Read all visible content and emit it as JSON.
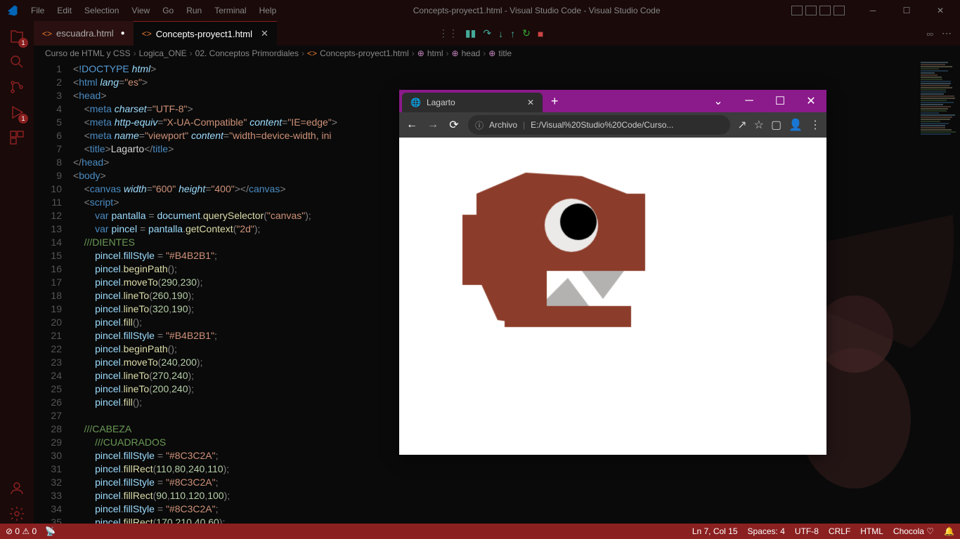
{
  "titlebar": {
    "menu": [
      "File",
      "Edit",
      "Selection",
      "View",
      "Go",
      "Run",
      "Terminal",
      "Help"
    ],
    "title": "Concepts-proyect1.html - Visual Studio Code - Visual Studio Code"
  },
  "activitybar": {
    "explorer_badge": "1",
    "debug_badge": "1"
  },
  "tabs": {
    "items": [
      {
        "name": "escuadra.html",
        "active": false,
        "modified": true
      },
      {
        "name": "Concepts-proyect1.html",
        "active": true,
        "modified": false
      }
    ]
  },
  "breadcrumb": {
    "items": [
      "Curso de HTML y CSS",
      "Logica_ONE",
      "02. Conceptos Primordiales",
      "Concepts-proyect1.html",
      "html",
      "head",
      "title"
    ]
  },
  "code": {
    "lines": [
      {
        "n": 1,
        "html": "<span class='k-punc'>&lt;</span><span class='k-doc'>!DOCTYPE</span> <span class='k-attr'>html</span><span class='k-punc'>&gt;</span>"
      },
      {
        "n": 2,
        "html": "<span class='k-punc'>&lt;</span><span class='k-tag'>html</span> <span class='k-attr'>lang</span><span class='k-punc'>=</span><span class='k-str'>\"es\"</span><span class='k-punc'>&gt;</span>"
      },
      {
        "n": 3,
        "html": "<span class='k-punc'>&lt;</span><span class='k-tag'>head</span><span class='k-punc'>&gt;</span>"
      },
      {
        "n": 4,
        "html": "    <span class='k-punc'>&lt;</span><span class='k-tag'>meta</span> <span class='k-attr'>charset</span><span class='k-punc'>=</span><span class='k-str'>\"UTF-8\"</span><span class='k-punc'>&gt;</span>"
      },
      {
        "n": 5,
        "html": "    <span class='k-punc'>&lt;</span><span class='k-tag'>meta</span> <span class='k-attr'>http-equiv</span><span class='k-punc'>=</span><span class='k-str'>\"X-UA-Compatible\"</span> <span class='k-attr'>content</span><span class='k-punc'>=</span><span class='k-str'>\"IE=edge\"</span><span class='k-punc'>&gt;</span>"
      },
      {
        "n": 6,
        "html": "    <span class='k-punc'>&lt;</span><span class='k-tag'>meta</span> <span class='k-attr'>name</span><span class='k-punc'>=</span><span class='k-str'>\"viewport\"</span> <span class='k-attr'>content</span><span class='k-punc'>=</span><span class='k-str'>\"width=device-width, ini</span>"
      },
      {
        "n": 7,
        "html": "    <span class='k-punc'>&lt;</span><span class='k-tag'>title</span><span class='k-punc'>&gt;</span>Lagarto<span class='k-punc'>&lt;/</span><span class='k-tag'>title</span><span class='k-punc'>&gt;</span>"
      },
      {
        "n": 8,
        "html": "<span class='k-punc'>&lt;/</span><span class='k-tag'>head</span><span class='k-punc'>&gt;</span>"
      },
      {
        "n": 9,
        "html": "<span class='k-punc'>&lt;</span><span class='k-tag'>body</span><span class='k-punc'>&gt;</span>"
      },
      {
        "n": 10,
        "html": "    <span class='k-punc'>&lt;</span><span class='k-tag'>canvas</span> <span class='k-attr'>width</span><span class='k-punc'>=</span><span class='k-str'>\"600\"</span> <span class='k-attr'>height</span><span class='k-punc'>=</span><span class='k-str'>\"400\"</span><span class='k-punc'>&gt;&lt;/</span><span class='k-tag'>canvas</span><span class='k-punc'>&gt;</span>"
      },
      {
        "n": 11,
        "html": "    <span class='k-punc'>&lt;</span><span class='k-tag'>script</span><span class='k-punc'>&gt;</span>"
      },
      {
        "n": 12,
        "html": "        <span class='k-kw'>var</span> <span class='k-var'>pantalla</span> <span class='k-punc'>=</span> <span class='k-obj'>document</span><span class='k-punc'>.</span><span class='k-func'>querySelector</span><span class='k-punc'>(</span><span class='k-str'>\"canvas\"</span><span class='k-punc'>);</span>"
      },
      {
        "n": 13,
        "html": "        <span class='k-kw'>var</span> <span class='k-var'>pincel</span> <span class='k-punc'>=</span> <span class='k-obj'>pantalla</span><span class='k-punc'>.</span><span class='k-func'>getContext</span><span class='k-punc'>(</span><span class='k-str'>\"2d\"</span><span class='k-punc'>);</span>"
      },
      {
        "n": 14,
        "html": "    <span class='k-com'>///DIENTES</span>"
      },
      {
        "n": 15,
        "html": "        <span class='k-obj'>pincel</span><span class='k-punc'>.</span><span class='k-var'>fillStyle</span> <span class='k-punc'>=</span> <span class='k-str'>\"#B4B2B1\"</span><span class='k-punc'>;</span>"
      },
      {
        "n": 16,
        "html": "        <span class='k-obj'>pincel</span><span class='k-punc'>.</span><span class='k-func'>beginPath</span><span class='k-punc'>();</span>"
      },
      {
        "n": 17,
        "html": "        <span class='k-obj'>pincel</span><span class='k-punc'>.</span><span class='k-func'>moveTo</span><span class='k-punc'>(</span><span class='k-num'>290</span><span class='k-punc'>,</span><span class='k-num'>230</span><span class='k-punc'>);</span>"
      },
      {
        "n": 18,
        "html": "        <span class='k-obj'>pincel</span><span class='k-punc'>.</span><span class='k-func'>lineTo</span><span class='k-punc'>(</span><span class='k-num'>260</span><span class='k-punc'>,</span><span class='k-num'>190</span><span class='k-punc'>);</span>"
      },
      {
        "n": 19,
        "html": "        <span class='k-obj'>pincel</span><span class='k-punc'>.</span><span class='k-func'>lineTo</span><span class='k-punc'>(</span><span class='k-num'>320</span><span class='k-punc'>,</span><span class='k-num'>190</span><span class='k-punc'>);</span>"
      },
      {
        "n": 20,
        "html": "        <span class='k-obj'>pincel</span><span class='k-punc'>.</span><span class='k-func'>fill</span><span class='k-punc'>();</span>"
      },
      {
        "n": 21,
        "html": "        <span class='k-obj'>pincel</span><span class='k-punc'>.</span><span class='k-var'>fillStyle</span> <span class='k-punc'>=</span> <span class='k-str'>\"#B4B2B1\"</span><span class='k-punc'>;</span>"
      },
      {
        "n": 22,
        "html": "        <span class='k-obj'>pincel</span><span class='k-punc'>.</span><span class='k-func'>beginPath</span><span class='k-punc'>();</span>"
      },
      {
        "n": 23,
        "html": "        <span class='k-obj'>pincel</span><span class='k-punc'>.</span><span class='k-func'>moveTo</span><span class='k-punc'>(</span><span class='k-num'>240</span><span class='k-punc'>,</span><span class='k-num'>200</span><span class='k-punc'>);</span>"
      },
      {
        "n": 24,
        "html": "        <span class='k-obj'>pincel</span><span class='k-punc'>.</span><span class='k-func'>lineTo</span><span class='k-punc'>(</span><span class='k-num'>270</span><span class='k-punc'>,</span><span class='k-num'>240</span><span class='k-punc'>);</span>"
      },
      {
        "n": 25,
        "html": "        <span class='k-obj'>pincel</span><span class='k-punc'>.</span><span class='k-func'>lineTo</span><span class='k-punc'>(</span><span class='k-num'>200</span><span class='k-punc'>,</span><span class='k-num'>240</span><span class='k-punc'>);</span>"
      },
      {
        "n": 26,
        "html": "        <span class='k-obj'>pincel</span><span class='k-punc'>.</span><span class='k-func'>fill</span><span class='k-punc'>();</span>"
      },
      {
        "n": 27,
        "html": ""
      },
      {
        "n": 28,
        "html": "    <span class='k-com'>///CABEZA</span>"
      },
      {
        "n": 29,
        "html": "        <span class='k-com'>///CUADRADOS</span>"
      },
      {
        "n": 30,
        "html": "        <span class='k-obj'>pincel</span><span class='k-punc'>.</span><span class='k-var'>fillStyle</span> <span class='k-punc'>=</span> <span class='k-str'>\"#8C3C2A\"</span><span class='k-punc'>;</span>"
      },
      {
        "n": 31,
        "html": "        <span class='k-obj'>pincel</span><span class='k-punc'>.</span><span class='k-func'>fillRect</span><span class='k-punc'>(</span><span class='k-num'>110</span><span class='k-punc'>,</span><span class='k-num'>80</span><span class='k-punc'>,</span><span class='k-num'>240</span><span class='k-punc'>,</span><span class='k-num'>110</span><span class='k-punc'>);</span>"
      },
      {
        "n": 32,
        "html": "        <span class='k-obj'>pincel</span><span class='k-punc'>.</span><span class='k-var'>fillStyle</span> <span class='k-punc'>=</span> <span class='k-str'>\"#8C3C2A\"</span><span class='k-punc'>;</span>"
      },
      {
        "n": 33,
        "html": "        <span class='k-obj'>pincel</span><span class='k-punc'>.</span><span class='k-func'>fillRect</span><span class='k-punc'>(</span><span class='k-num'>90</span><span class='k-punc'>,</span><span class='k-num'>110</span><span class='k-punc'>,</span><span class='k-num'>120</span><span class='k-punc'>,</span><span class='k-num'>100</span><span class='k-punc'>);</span>"
      },
      {
        "n": 34,
        "html": "        <span class='k-obj'>pincel</span><span class='k-punc'>.</span><span class='k-var'>fillStyle</span> <span class='k-punc'>=</span> <span class='k-str'>\"#8C3C2A\"</span><span class='k-punc'>;</span>"
      },
      {
        "n": 35,
        "html": "        <span class='k-obj'>pincel</span><span class='k-punc'>.</span><span class='k-func'>fillRect</span><span class='k-punc'>(</span><span class='k-num'>170</span><span class='k-punc'>,</span><span class='k-num'>210</span><span class='k-punc'>,</span><span class='k-num'>40</span><span class='k-punc'>,</span><span class='k-num'>60</span><span class='k-punc'>);</span>"
      }
    ]
  },
  "statusbar": {
    "errors": "0",
    "warnings": "0",
    "position": "Ln 7, Col 15",
    "spaces": "Spaces: 4",
    "encoding": "UTF-8",
    "eol": "CRLF",
    "language": "HTML",
    "extension": "Chocola ♡",
    "notifications": ""
  },
  "browser": {
    "tab_title": "Lagarto",
    "url_label": "Archivo",
    "url": "E:/Visual%20Studio%20Code/Curso..."
  }
}
